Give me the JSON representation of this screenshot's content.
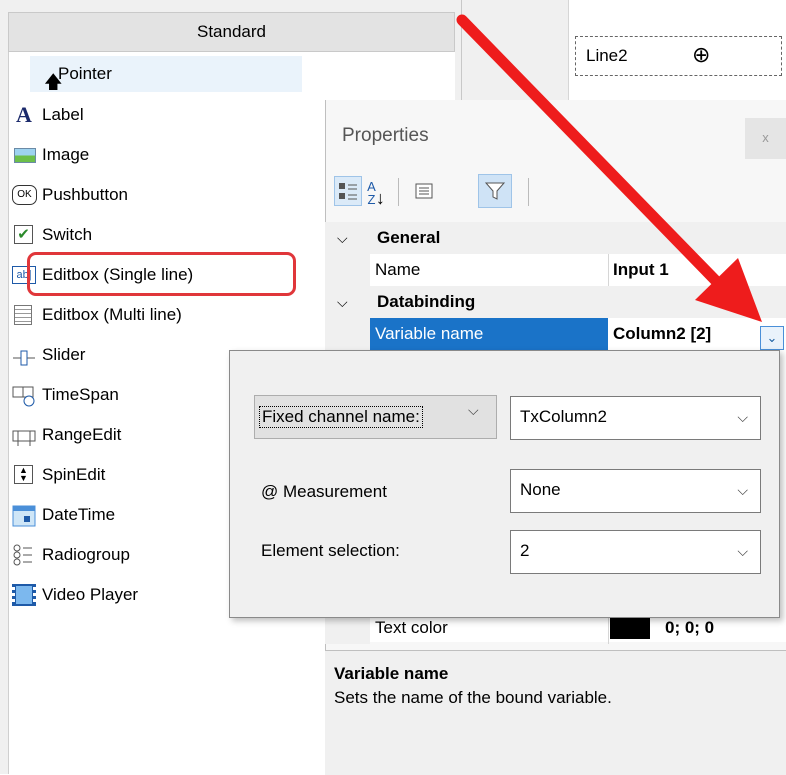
{
  "toolbox": {
    "header": "Standard",
    "items": [
      {
        "label": "Pointer",
        "icon": "pointer-icon"
      },
      {
        "label": "Label",
        "icon": "label-a-icon"
      },
      {
        "label": "Image",
        "icon": "image-icon"
      },
      {
        "label": "Pushbutton",
        "icon": "ok-button-icon"
      },
      {
        "label": "Switch",
        "icon": "checkbox-icon"
      },
      {
        "label": "Editbox (Single line)",
        "icon": "editbox-single-icon"
      },
      {
        "label": "Editbox (Multi line)",
        "icon": "editbox-multi-icon"
      },
      {
        "label": "Slider",
        "icon": "slider-icon"
      },
      {
        "label": "TimeSpan",
        "icon": "timespan-icon"
      },
      {
        "label": "RangeEdit",
        "icon": "rangeedit-icon"
      },
      {
        "label": "SpinEdit",
        "icon": "spinedit-icon"
      },
      {
        "label": "DateTime",
        "icon": "datetime-icon"
      },
      {
        "label": "Radiogroup",
        "icon": "radiogroup-icon"
      },
      {
        "label": "Video Player",
        "icon": "video-player-icon"
      }
    ]
  },
  "designer": {
    "element_text": "Line2"
  },
  "properties": {
    "title": "Properties",
    "close": "x",
    "categories": {
      "general": "General",
      "databinding": "Databinding"
    },
    "rows": {
      "name": {
        "label": "Name",
        "value": "Input 1"
      },
      "variable_name": {
        "label": "Variable name",
        "value": "Column2 [2]"
      },
      "text_color": {
        "label": "Text color",
        "value": "0; 0; 0"
      }
    },
    "description": {
      "title": "Variable name",
      "text": "Sets the name of the bound variable."
    }
  },
  "binding_popup": {
    "channel_mode": "Fixed channel name:",
    "channel_value": "TxColumn2",
    "measurement_label": "@ Measurement",
    "measurement_value": "None",
    "element_label": "Element selection:",
    "element_value": "2"
  },
  "colors": {
    "highlight_red": "#e0363a",
    "selection_blue": "#1a73c8",
    "arrow_red": "#ee1c1c"
  }
}
